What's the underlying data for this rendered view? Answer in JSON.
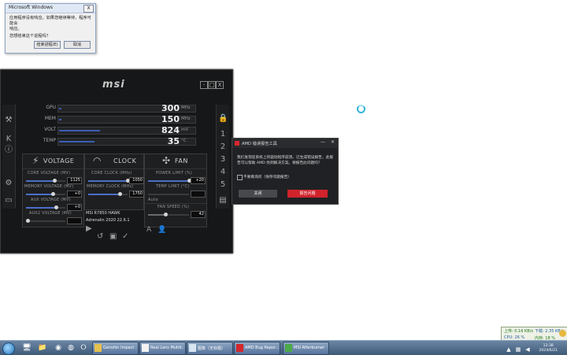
{
  "msgbox": {
    "title": "Microsoft Windows",
    "line1": "应用程序没有响应。如果您继续等待，程序可能会",
    "line2": "响应。",
    "line3": "您想结束这个进程吗？",
    "end_btn": "结束进程(E)",
    "cancel_btn": "取消",
    "close": "X"
  },
  "afterburner": {
    "logo": "msi",
    "win_controls": [
      "-",
      "□",
      "X"
    ],
    "metrics": [
      {
        "label": "GPU",
        "value": "300",
        "unit": "MHz",
        "fill": 0.02
      },
      {
        "label": "MEM",
        "value": "150",
        "unit": "MHz",
        "fill": 0.02
      },
      {
        "label": "VOLT",
        "value": "824",
        "unit": "mV",
        "fill": 0.3
      },
      {
        "label": "TEMP",
        "value": "35",
        "unit": "°C",
        "fill": 0.26
      }
    ],
    "voltage": {
      "title": "VOLTAGE",
      "core_label": "CORE VOLTAGE (MV)",
      "core_val": "1125",
      "memory_label": "MEMORY VOLTAGE (MV)",
      "memory_val": "+0",
      "aux_label": "AUX VOLTAGE (MV)",
      "aux_val": "+0",
      "aux2_label": "AUX2 VOLTAGE (MV)",
      "aux2_val": ""
    },
    "clock": {
      "title": "CLOCK",
      "core_label": "CORE CLOCK (MHz)",
      "core_val": "1050",
      "memory_label": "MEMORY CLOCK (MHz)",
      "memory_val": "1750"
    },
    "fan": {
      "title": "FAN",
      "power_label": "POWER LIMIT (%)",
      "power_val": "+20",
      "temp_label": "TEMP LIMIT (°C)",
      "temp_val": "",
      "speed_label": "FAN SPEED (%)",
      "speed_val": "42",
      "auto_label": "Auto"
    },
    "gpu_name": "MSI R7850 HAWK",
    "driver": "Adrenalin 2020 22.6.1"
  },
  "amd": {
    "title": "AMD 错误报告工具",
    "minimize": "—",
    "close": "✕",
    "message": "我们发现您系统上的驱动程序崩溃。已生成错误报告。此报告可以帮助 AMD 找到解决方案。要报告此问题吗？",
    "checkbox": "不要再询问（保存问题报告）",
    "close_btn": "关闭",
    "report_btn": "报告问题"
  },
  "net": {
    "up": "上传: 0.16 KB/s",
    "down": "下载: 2.35 KB/s",
    "cpu": "CPU: 26 %",
    "mem": "内存: 18 %"
  },
  "taskbar": {
    "tasks": [
      "Genshin Impact ...",
      "Real Lens Multit...",
      "图像（无标题）",
      "AMD Bug Repor...",
      "MSI Afterburner"
    ],
    "time": "13:38",
    "date": "2024/6/21"
  }
}
